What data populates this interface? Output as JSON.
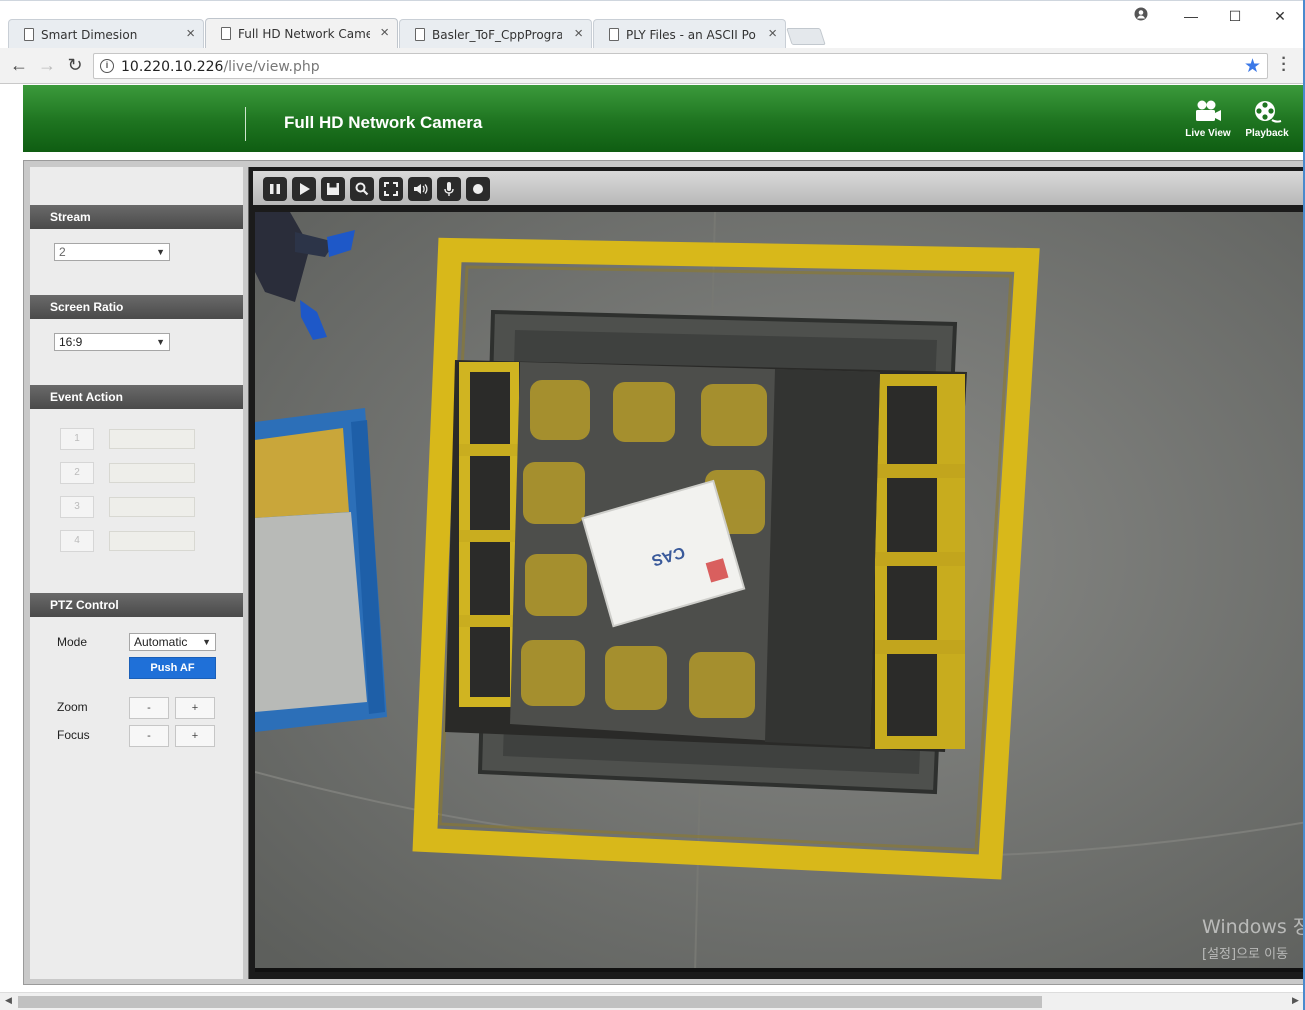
{
  "browser": {
    "tabs": [
      {
        "title": "Smart Dimesion",
        "close": "×"
      },
      {
        "title": "Full HD Network Camer",
        "close": "×"
      },
      {
        "title": "Basler_ToF_CppProgram",
        "close": "×"
      },
      {
        "title": "PLY Files - an ASCII Pol",
        "close": "×"
      }
    ],
    "window_controls": {
      "minimize": "—",
      "maximize": "☐",
      "close": "✕"
    },
    "nav": {
      "back": "←",
      "forward": "→",
      "reload": "↻"
    },
    "url_host": "10.220.10.226",
    "url_path": "/live/view.php",
    "menu": "⋮"
  },
  "header": {
    "title": "Full HD Network Camera",
    "live_view_label": "Live View",
    "playback_label": "Playback",
    "brand_color": "#1e7420"
  },
  "left_panel": {
    "stream": {
      "title": "Stream",
      "value": "2"
    },
    "screen_ratio": {
      "title": "Screen Ratio",
      "value": "16:9"
    },
    "event_action": {
      "title": "Event Action",
      "items": [
        "1",
        "2",
        "3",
        "4"
      ]
    },
    "ptz": {
      "title": "PTZ Control",
      "mode_label": "Mode",
      "mode_value": "Automatic",
      "push_af": "Push AF",
      "zoom_label": "Zoom",
      "focus_label": "Focus",
      "minus": "-",
      "plus": "+"
    }
  },
  "video_toolbar": {
    "buttons": [
      "pause",
      "play",
      "save",
      "zoom",
      "fullscreen",
      "audio",
      "microphone",
      "record"
    ]
  },
  "video": {
    "box_text": "CAS",
    "watermark_line1": "Windows 정",
    "watermark_line2": "[설정]으로 이동"
  }
}
